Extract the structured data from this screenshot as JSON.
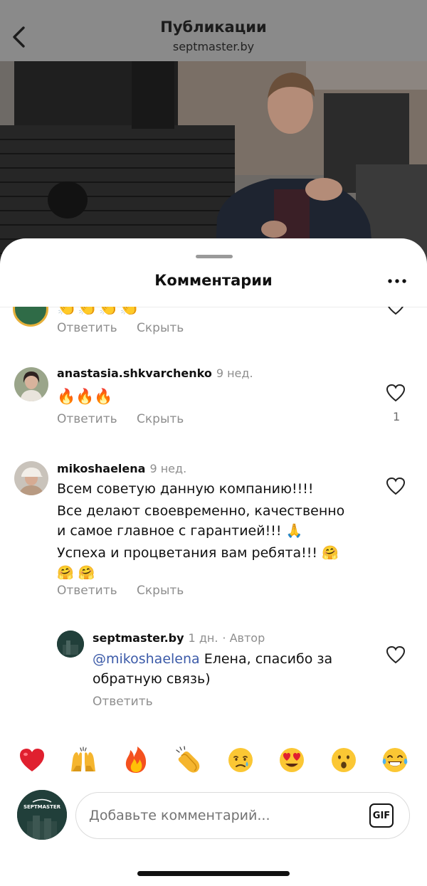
{
  "header": {
    "title": "Публикации",
    "subtitle": "septmaster.by"
  },
  "sheet": {
    "title": "Комментарии"
  },
  "comments": [
    {
      "reactions": "👏👏👏👏",
      "reply_label": "Ответить",
      "hide_label": "Скрыть"
    },
    {
      "username": "anastasia.shkvarchenko",
      "time": "9 нед.",
      "text": "🔥🔥🔥",
      "reply_label": "Ответить",
      "hide_label": "Скрыть",
      "likes": "1"
    },
    {
      "username": "mikoshaelena",
      "time": "9 нед.",
      "lines": [
        "Всем советую данную компанию!!!!",
        "Все делают своевременно, качественно",
        "и самое главное с гарантией!!! 🙏",
        "Успеха и процветания вам ребята!!! 🤗",
        "🤗 🤗"
      ],
      "reply_label": "Ответить",
      "hide_label": "Скрыть"
    }
  ],
  "reply": {
    "username": "septmaster.by",
    "time": "1 дн.",
    "author_tag": "· Автор",
    "mention": "@mikoshaelena",
    "text_line1": " Елена, спасибо за",
    "text_line2": "обратную связь)",
    "reply_label": "Ответить"
  },
  "emoji_bar": [
    {
      "name": "heart",
      "glyph": "❤️"
    },
    {
      "name": "raising-hands",
      "glyph": "🙌"
    },
    {
      "name": "fire",
      "glyph": "🔥"
    },
    {
      "name": "clapping-hands",
      "glyph": "👏"
    },
    {
      "name": "crying-face",
      "glyph": "😢"
    },
    {
      "name": "heart-eyes",
      "glyph": "😍"
    },
    {
      "name": "surprised-face",
      "glyph": "😮"
    },
    {
      "name": "tears-of-joy",
      "glyph": "😂"
    }
  ],
  "composer": {
    "placeholder": "Добавьте комментарий...",
    "gif_label": "GIF",
    "avatar_text": "SEPTMASTER"
  }
}
